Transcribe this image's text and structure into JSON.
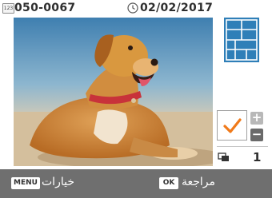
{
  "header": {
    "file_icon_text": "123",
    "file_number": "050-0067",
    "date": "02/02/2017"
  },
  "photo": {
    "description_icon": "dog-photo"
  },
  "side": {
    "layout_icon": "print-layout-icon",
    "selected": true,
    "copies": "1"
  },
  "footer": {
    "menu_key": "MENU",
    "menu_label": "خيارات",
    "ok_key": "OK",
    "ok_label": "مراجعة"
  },
  "colors": {
    "accent_blue": "#2f7fb8",
    "check_orange": "#f07a1a",
    "bar_gray": "#6f6f6f"
  }
}
